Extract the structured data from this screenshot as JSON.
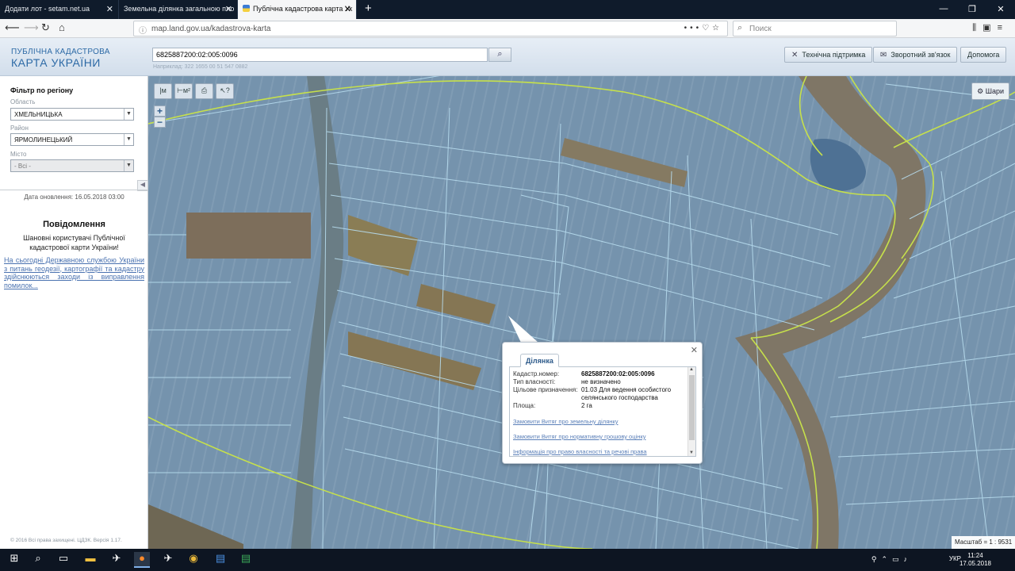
{
  "browser": {
    "tabs": [
      {
        "title": "Додати лот - setam.net.ua",
        "active": false
      },
      {
        "title": "Земельна ділянка загальною пло",
        "active": false
      },
      {
        "title": "Публічна кадастрова карта Ук",
        "active": true
      }
    ],
    "url": "map.land.gov.ua/kadastrova-karta",
    "search_placeholder": "Поиск"
  },
  "app": {
    "logo_line1": "ПУБЛІЧНА КАДАСТРОВА",
    "logo_line2": "КАРТА УКРАЇНИ",
    "cad_search_value": "6825887200:02:005:0096",
    "cad_example": "Наприклад: 322 1655 00 51 547 0882",
    "header_buttons": {
      "tech_support": "Технічна підтримка",
      "feedback": "Зворотний зв'язок",
      "help": "Допомога"
    }
  },
  "sidebar": {
    "filter_title": "Фільтр по регіону",
    "region_label": "Область",
    "region_value": "ХМЕЛЬНИЦЬКА",
    "district_label": "Район",
    "district_value": "ЯРМОЛИНЕЦЬКИЙ",
    "city_label": "Місто",
    "city_value": "- Всі -",
    "update_date": "Дата оновлення: 16.05.2018 03:00",
    "message_title": "Повідомлення",
    "message_text": "Шановні користувачі Публічної кадастрової карти України!",
    "message_link": "На сьогодні Державною службою України з питань геодезії, картографії та кадастру здійснюються заходи із виправлення помилок...",
    "copyright": "© 2016 Всі права захищені. ЦДЗК. Версія 1.17."
  },
  "map": {
    "layers_label": "Шари",
    "scale_text": "Масштаб = 1 : 9531",
    "popup": {
      "tab": "Ділянка",
      "rows": [
        {
          "label": "Кадастр.номер:",
          "value": "6825887200:02:005:0096"
        },
        {
          "label": "Тип власності:",
          "value": "не визначено"
        },
        {
          "label": "Цільове призначення:",
          "value": "01.03 Для ведення особистого селянського господарства"
        },
        {
          "label": "Площа:",
          "value": "2 га"
        }
      ],
      "links": [
        "Замовити Витяг про земельну ділянку",
        "Замовити Витяг про нормативну грошову оцінку",
        "Інформація про право власності та речові права"
      ]
    }
  },
  "taskbar": {
    "lang": "УКР",
    "time": "11:24",
    "date": "17.05.2018"
  }
}
